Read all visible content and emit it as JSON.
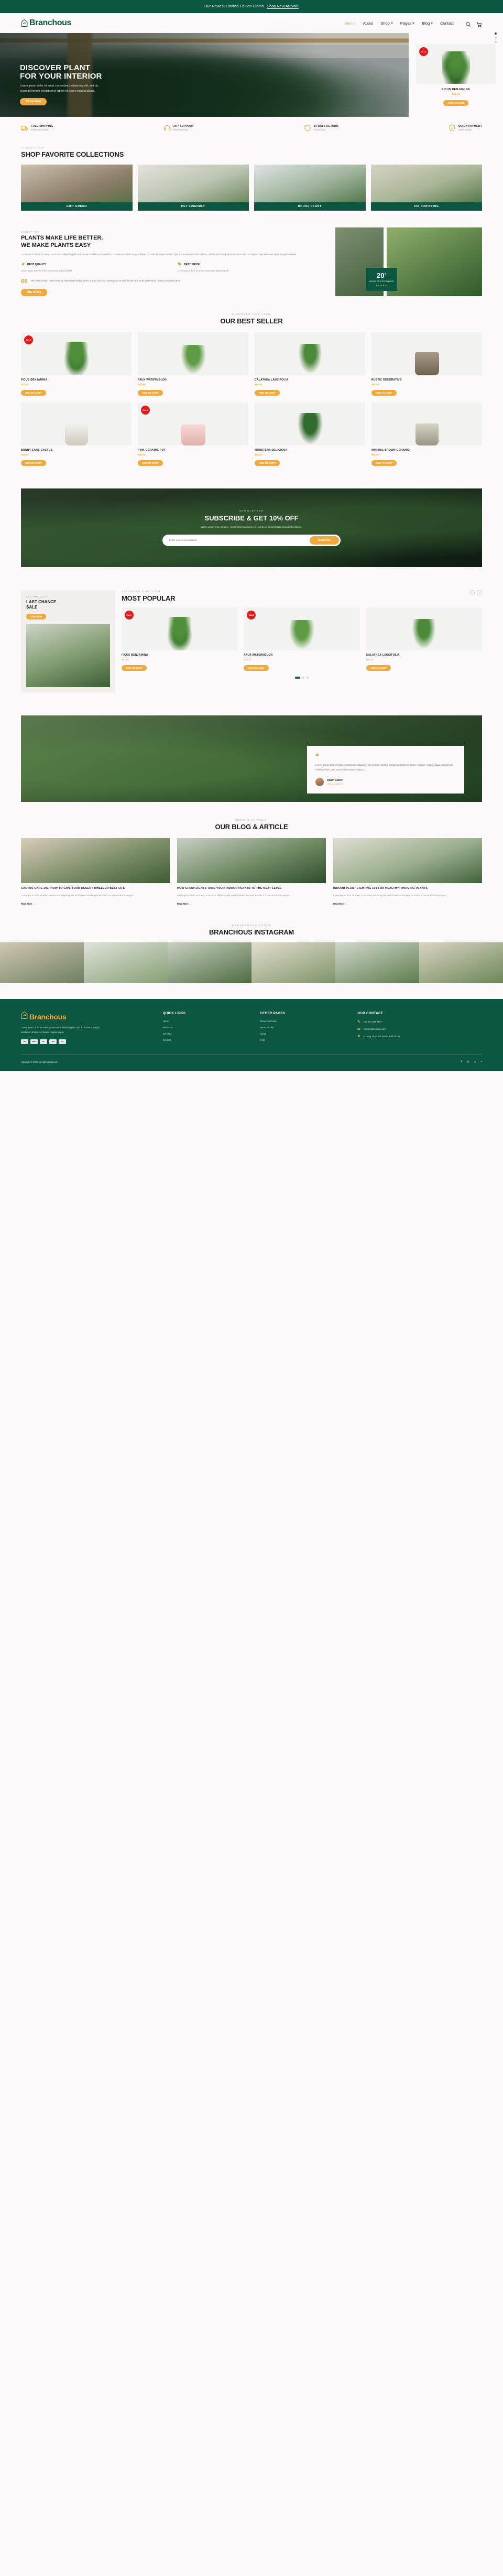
{
  "announcement": {
    "text": "Our Newest Limited-Edition Plants",
    "link": "Shop New Arrivals"
  },
  "brand": {
    "name": "Branchous"
  },
  "nav": {
    "items": [
      {
        "label": "Home",
        "active": true,
        "caret": false
      },
      {
        "label": "About",
        "active": false,
        "caret": false
      },
      {
        "label": "Shop",
        "active": false,
        "caret": true
      },
      {
        "label": "Pages",
        "active": false,
        "caret": true
      },
      {
        "label": "Blog",
        "active": false,
        "caret": true
      },
      {
        "label": "Contact",
        "active": false,
        "caret": false
      }
    ],
    "icons": [
      "search-icon",
      "cart-icon"
    ]
  },
  "hero": {
    "title_line1": "DISCOVER PLANT",
    "title_line2": "FOR YOUR INTERIOR",
    "desc": "Lorem ipsum dolor sit amet, consectetur adipiscing elit, sed do eiusmod tempor incididunt ut labore et dolore magna aliqua.",
    "cta": "Shop Now",
    "card": {
      "badge": "SALE",
      "name": "FICUS BENJAMINA",
      "price": "$54.00",
      "cta": "ADD TO CART"
    }
  },
  "features": [
    {
      "icon": "truck-icon",
      "title": "FREE SHIPPING",
      "sub": "Orders Over $100"
    },
    {
      "icon": "headset-icon",
      "title": "24/7 SUPPORT",
      "sub": "Reach Us Fast"
    },
    {
      "icon": "return-icon",
      "title": "14 DAYS RETURN",
      "sub": "Free Return"
    },
    {
      "icon": "shield-icon",
      "title": "QUICK PAYMENT",
      "sub": "100% Secure"
    }
  ],
  "collections": {
    "eyebrow": "COLLECTION",
    "heading": "SHOP FAVORITE COLLECTIONS",
    "items": [
      {
        "label": "GIFT GREEN"
      },
      {
        "label": "PET FRIENDLY"
      },
      {
        "label": "HOUSE PLANT"
      },
      {
        "label": "AIR PURIFYING"
      }
    ]
  },
  "about": {
    "eyebrow": "ABOUT US",
    "title_line1": "PLANTS MAKE LIFE BETTER.",
    "title_line2": "WE MAKE PLANTS EASY",
    "lead": "Lorem ipsum dolor sit amet, consectetur adipiscing elit, sed do eiusmod tempor incididunt ut labore et dolore magna aliqua. Ut enim ad minim veniam, quis nostrud exercitation ullamco laboris nisi ut aliquip ex ea commodo consequat. Duis aute irure dolor in reprehenderit.",
    "points": [
      {
        "title": "BEST QUALITY",
        "desc": "Lorem ipsum dolor sit amet consectetur adipiscing elit."
      },
      {
        "title": "BEST PRICE",
        "desc": "Lorem ipsum dolor sit amet consectetur adipiscing elit."
      }
    ],
    "quote_mark": "66",
    "quote": "We make buying plants easy by delivering healthy plants to your door and setting you up with the tips and tricks you need to keep your plants grow.",
    "cta": "Our Story",
    "years_number": "20",
    "years_sup": "+",
    "years_label": "YEARS OF EXPERIENCE",
    "stars": "★★★★★"
  },
  "best_seller": {
    "eyebrow": "DISCOVER OUR ITEM",
    "heading": "OUR BEST SELLER",
    "products": [
      {
        "name": "FICUS BENJAMINA",
        "price": "$54.00",
        "sale": true,
        "cta": "ADD TO CART",
        "art": "p-ficus"
      },
      {
        "name": "FAUX WATERMELON",
        "price": "$28.00",
        "sale": false,
        "cta": "ADD TO CART",
        "art": "p-melon"
      },
      {
        "name": "CALATHEA LANCIFOLIA",
        "price": "$63.00",
        "sale": false,
        "cta": "ADD TO CART",
        "art": "p-cala"
      },
      {
        "name": "RUSTIC DECORATIVE",
        "price": "$80.00",
        "sale": false,
        "cta": "ADD TO CART",
        "art": "p-pot-r"
      },
      {
        "name": "BUNNY EARS CACTUS",
        "price": "$45.00",
        "sale": false,
        "cta": "ADD TO CART",
        "art": "p-pot-w"
      },
      {
        "name": "PINK CERAMIC POT",
        "price": "$68.00",
        "sale": true,
        "cta": "ADD TO CART",
        "art": "p-pot-p"
      },
      {
        "name": "MONSTERA DELICIOSA",
        "price": "$36.00",
        "sale": false,
        "cta": "ADD TO CART",
        "art": "p-mon"
      },
      {
        "name": "MINIMAL BROWN CERAMIC",
        "price": "$55.00",
        "sale": false,
        "cta": "ADD TO CART",
        "art": "p-pot-g"
      }
    ]
  },
  "newsletter": {
    "eyebrow": "NEWSLETTER",
    "heading": "SUBSCRIBE & GET 10% OFF",
    "desc": "Lorem ipsum dolor sit amet, consectetur adipiscing elit, sed do eiusmod tempor incididunt ut labore.",
    "placeholder": "Enter your email address",
    "button": "Subscribe"
  },
  "popular": {
    "eyebrow": "DISCOVER OUR ITEM",
    "heading": "MOST POPULAR",
    "promo": {
      "eyebrow": "ALL PRODUCT",
      "title_line1": "LAST CHANCE",
      "title_line2": "SALE",
      "cta": "Shop Now"
    },
    "products": [
      {
        "name": "FICUS BENJAMINA",
        "price": "$54.00",
        "sale": true,
        "cta": "ADD TO CART",
        "art": "p-ficus"
      },
      {
        "name": "FAUX WATERMELON",
        "price": "$28.00",
        "sale": true,
        "cta": "ADD TO CART",
        "art": "p-melon"
      },
      {
        "name": "CALATHEA LANCIFOLIA",
        "price": "$63.00",
        "sale": false,
        "cta": "ADD TO CART",
        "art": "p-cala"
      }
    ],
    "prev": "‹",
    "next": "›"
  },
  "testimonial": {
    "marks": "❝",
    "text": "Lorem ipsum dolor sit amet, consectetur adipiscing elit, sed do eiusmod tempor incididunt ut labore et dolore magna aliqua. Ut enim ad minim veniam, quis nostrud exercitation ullamco.",
    "name": "Adam Carter",
    "role": "Happy Customer"
  },
  "blog": {
    "eyebrow": "BLOG & ARTICLE",
    "heading": "OUR BLOG & ARTICLE",
    "posts": [
      {
        "title": "CACTUS CARE 101: HOW TO GIVE YOUR DESERT DWELLER BEST LIFE",
        "excerpt": "Lorem ipsum dolor sit amet, consectetur adipiscing elit, sed do eiusmod tempor incididunt ut labore et dolore magna.",
        "more": "Read More →",
        "art": "b1"
      },
      {
        "title": "HOW GROW LIGHTS TAKE YOUR INDOOR PLANTS TO THE NEXT LEVEL",
        "excerpt": "Lorem ipsum dolor sit amet, consectetur adipiscing elit, sed do eiusmod tempor incididunt ut labore et dolore magna.",
        "more": "Read More →",
        "art": "b2"
      },
      {
        "title": "INDOOR PLANT LIGHTING 101 FOR HEALTHY, THRIVING PLANTS",
        "excerpt": "Lorem ipsum dolor sit amet, consectetur adipiscing elit, sed do eiusmod tempor incididunt ut labore et dolore magna.",
        "more": "Read More →",
        "art": "b3"
      }
    ]
  },
  "instagram": {
    "eyebrow": "@BRANCHOUS.STORE",
    "heading": "BRANCHOUS INSTAGRAM",
    "tiles": [
      "g1",
      "g2",
      "g3",
      "g4",
      "g5",
      "g6"
    ]
  },
  "footer": {
    "brand": "Branchous",
    "desc": "Lorem ipsum dolor sit amet, consectetur adipiscing elit, sed do eiusmod tempor incididunt ut labore et dolore magna aliqua.",
    "cards": [
      "VISA",
      "AMEX",
      "MC",
      "JCB",
      "Pay"
    ],
    "quick_links_title": "QUICK LINKS",
    "quick_links": [
      "Home",
      "About Us",
      "Services",
      "Contact"
    ],
    "other_pages_title": "OTHER PAGES",
    "other_pages": [
      "Privacy & Policy",
      "Terms of Use",
      "Credit",
      "FAQ"
    ],
    "contact_title": "OUR CONTACT",
    "contact": [
      {
        "icon": "phone-icon",
        "text": "+62 361 234 4567"
      },
      {
        "icon": "mail-icon",
        "text": "contact@domain.com"
      },
      {
        "icon": "pin-icon",
        "text": "Jl.Hang Tuah, Denpasar, Bali 80239"
      }
    ],
    "copyright": "Copyright © 2022. All rights reserved.",
    "socials": [
      "f",
      "◎",
      "p",
      "▪"
    ]
  },
  "colors": {
    "green": "#0b5741",
    "amber": "#f0a93f",
    "sale": "#e01b1b",
    "bg": "#fbf9f9"
  }
}
